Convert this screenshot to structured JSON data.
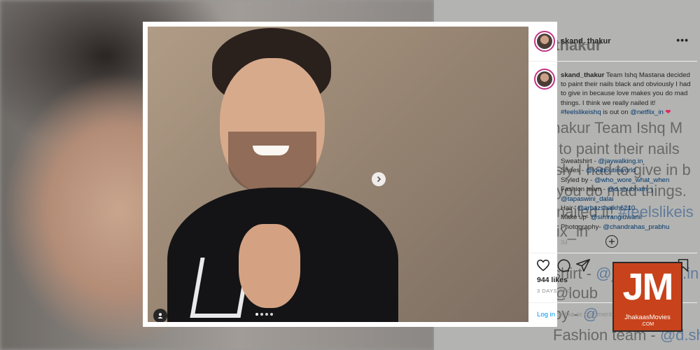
{
  "post": {
    "username": "skand_thakur",
    "caption_text": "Team Ishq Mastana decided to paint their nails black and obviously I had to give in because love makes you do mad things. I think we really nailed it!",
    "caption_hashtag": "#feelslikeishq",
    "caption_after": "is out on",
    "caption_mention": "@netflix_in",
    "caption_emoji": "❤",
    "credits": [
      {
        "label": "Sweatshirt - ",
        "tag": "@jaywalking.in"
      },
      {
        "label": "Shoes - ",
        "tag": "@louboutinworld"
      },
      {
        "label": "Styled by - ",
        "tag": "@who_wore_what_when"
      },
      {
        "label": "Fashion team - ",
        "tag": "@d.shubham_j"
      },
      {
        "label": "",
        "tag": "@tapaswini_dalai"
      },
      {
        "label": "Hair- ",
        "tag": "@arbazshaikh6210"
      },
      {
        "label": "Make up- ",
        "tag": "@simrangidwanii"
      },
      {
        "label": "Photography- ",
        "tag": "@chandrahas_prabhu"
      }
    ],
    "comment_time": "3d",
    "likes": "944 likes",
    "date": "3 DAYS AGO",
    "login_link": "Log in",
    "login_rest": " to like or comment.",
    "more_icon": "•••",
    "carousel_total": 4,
    "carousel_active": 1
  },
  "background": {
    "username": "_thakur",
    "lines": [
      "_thakur Team Ishq M",
      "d to paint their nails",
      "usly I had to give in b",
      "you do mad things.",
      "nailed it! ",
      "lix_in",
      "shirt - ",
      "by - ",
      "Fashion team - "
    ],
    "hashtag": "#feelslikeis",
    "tags": [
      "@jaywalking.in",
      "@loub",
      "@",
      "@d.shubh"
    ]
  },
  "watermark": {
    "letters": "JM",
    "name": "JhakaasMovies",
    "domain": ".COM"
  },
  "colors": {
    "link": "#00376b",
    "login_blue": "#0095f6",
    "watermark_bg": "#c8431b",
    "heart": "#e0245e"
  }
}
